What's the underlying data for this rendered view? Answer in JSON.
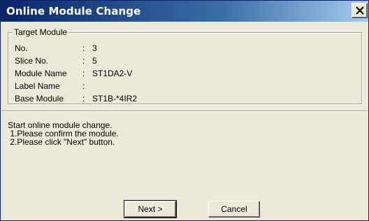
{
  "window": {
    "title": "Online Module Change"
  },
  "target_module": {
    "group_label": "Target Module",
    "fields": [
      {
        "label": "No.",
        "value": "3"
      },
      {
        "label": "Slice No.",
        "value": "5"
      },
      {
        "label": "Module Name",
        "value": "ST1DA2-V"
      },
      {
        "label": "Label Name",
        "value": ""
      },
      {
        "label": "Base Module",
        "value": "ST1B-*4IR2"
      }
    ]
  },
  "message": {
    "lines": [
      "Start online module change.",
      " 1.Please confirm the module.",
      " 2.Please click \"Next\" button."
    ]
  },
  "buttons": {
    "next_label": "Next >",
    "cancel_label": "Cancel"
  },
  "icons": {
    "close": "close-icon"
  },
  "colors": {
    "titlebar_start": "#0a246a",
    "titlebar_end": "#a6caf0",
    "dialog_bg": "#ece9d8"
  }
}
